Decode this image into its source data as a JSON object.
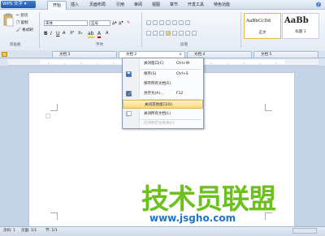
{
  "app": {
    "title": "WPS 文字"
  },
  "menu": {
    "tabs": [
      "开始",
      "插入",
      "页面布局",
      "引用",
      "审阅",
      "视图",
      "章节",
      "开发工具",
      "特色功能"
    ]
  },
  "ribbon": {
    "clipboard": {
      "cut": "剪切",
      "copy": "复制",
      "format_painter": "格式刷",
      "label": "剪贴板"
    },
    "font": {
      "name": "宋体",
      "size": "五号",
      "label": "字体"
    },
    "paragraph": {
      "label": "段落"
    },
    "styles": {
      "normal_preview": "AaBbCcDd",
      "normal_label": "正文",
      "h1_preview": "AaBb",
      "h1_label": "标题 1"
    }
  },
  "doc_tabs": [
    "文档 3",
    "文档 2",
    "文档 4",
    "文档 5"
  ],
  "context_menu": {
    "items": [
      {
        "label": "关闭窗口(C)",
        "shortcut": "Ctrl+W",
        "icon": "close-window-icon"
      },
      {
        "label": "保存(S)",
        "shortcut": "Ctrl+S",
        "icon": "save-icon"
      },
      {
        "label": "保存所有文档(E)",
        "shortcut": "",
        "icon": ""
      },
      {
        "label": "另存为(A)...",
        "shortcut": "F12",
        "icon": "save-as-icon"
      },
      {
        "label": "关闭其他窗口(O)",
        "shortcut": "",
        "icon": ""
      },
      {
        "label": "关闭所有文档(L)",
        "shortcut": "",
        "icon": "close-all-icon"
      },
      {
        "label": "打开所在文件夹(F)",
        "shortcut": "",
        "icon": ""
      }
    ]
  },
  "statusbar": {
    "page": "页码: 1",
    "pages": "页面: 1/1",
    "section": "节: 1/1"
  },
  "watermark": {
    "line1": "技术员联盟",
    "line2": "www.jsgho.com"
  },
  "colors": {
    "accent": "#2359a8",
    "highlight": "#fbd97a",
    "watermark_green": "#6cc11d",
    "watermark_blue": "#1c77c9"
  }
}
